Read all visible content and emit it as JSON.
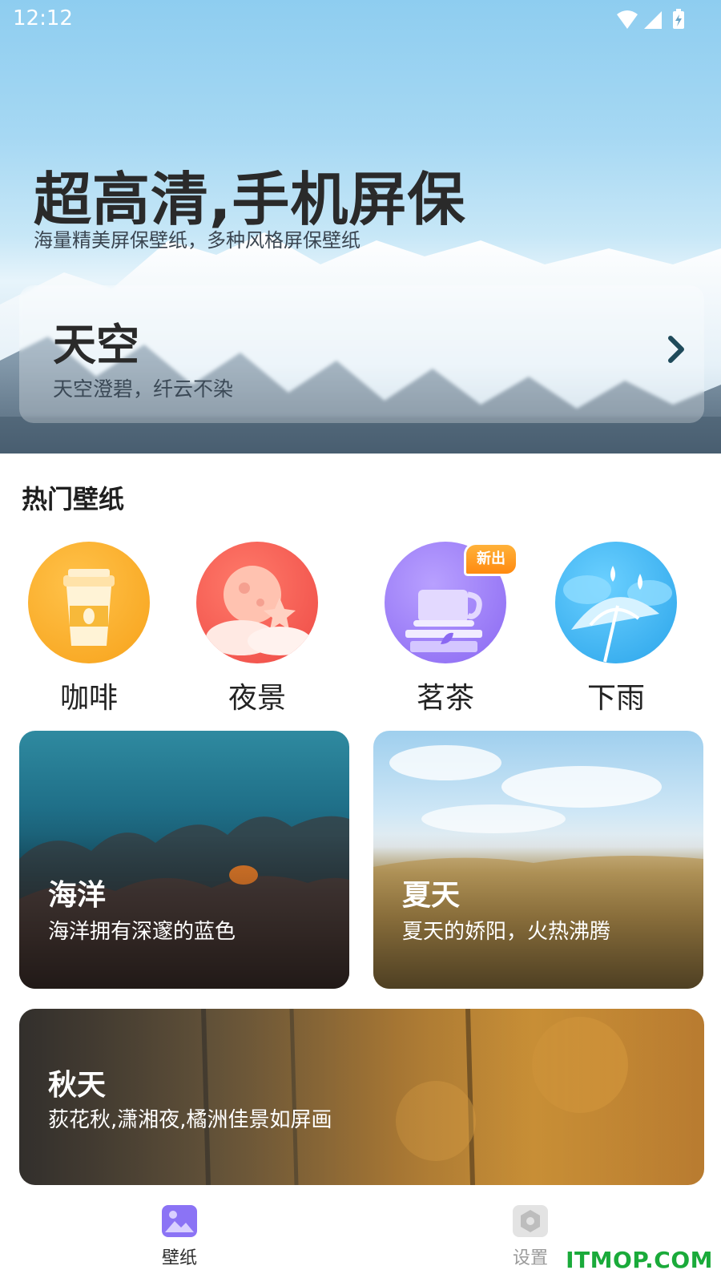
{
  "status": {
    "time": "12:12"
  },
  "hero": {
    "title": "超高清,手机屏保",
    "subtitle": "海量精美屏保壁纸，多种风格屏保壁纸",
    "card": {
      "title": "天空",
      "desc": "天空澄碧，纤云不染"
    }
  },
  "hot": {
    "title": "热门壁纸",
    "badge": "新出",
    "categories": [
      {
        "label": "咖啡",
        "icon": "coffee-cup-icon"
      },
      {
        "label": "夜景",
        "icon": "moon-night-icon"
      },
      {
        "label": "茗茶",
        "icon": "tea-cup-icon"
      },
      {
        "label": "下雨",
        "icon": "umbrella-rain-icon"
      }
    ]
  },
  "cards": [
    {
      "title": "海洋",
      "desc": "海洋拥有深邃的蓝色"
    },
    {
      "title": "夏天",
      "desc": "夏天的娇阳，火热沸腾"
    },
    {
      "title": "秋天",
      "desc": "荻花秋,潇湘夜,橘洲佳景如屏画"
    }
  ],
  "nav": {
    "items": [
      {
        "label": "壁纸",
        "icon": "wallpaper-icon",
        "active": true
      },
      {
        "label": "设置",
        "icon": "settings-icon",
        "active": false
      }
    ]
  },
  "watermark": "ITMOP.COM",
  "colors": {
    "accent": "#8b73f5",
    "badge": "#ff9a1e",
    "watermark": "#1aaa3a"
  }
}
